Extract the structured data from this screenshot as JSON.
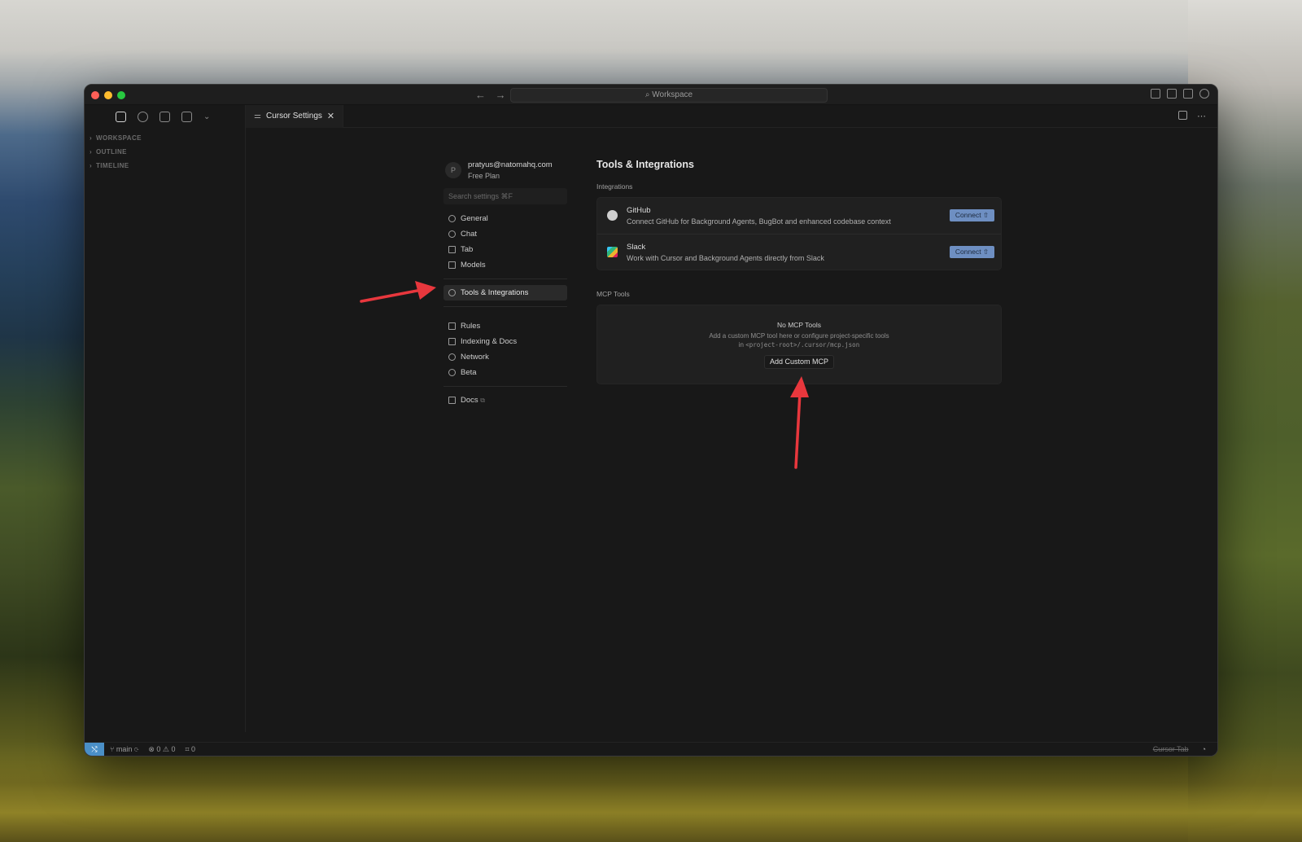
{
  "window": {
    "search_label": "Workspace",
    "nav_back": "←",
    "nav_forward": "→"
  },
  "sidebar": {
    "sections": [
      "WORKSPACE",
      "OUTLINE",
      "TIMELINE"
    ]
  },
  "tab": {
    "label": "Cursor Settings",
    "close": "✕"
  },
  "account": {
    "avatar_letter": "P",
    "email": "pratyus@natomahq.com",
    "plan": "Free Plan"
  },
  "settings_search": {
    "placeholder": "Search settings ⌘F"
  },
  "nav": {
    "general": "General",
    "chat": "Chat",
    "tab": "Tab",
    "models": "Models",
    "tools": "Tools & Integrations",
    "rules": "Rules",
    "indexing": "Indexing & Docs",
    "network": "Network",
    "beta": "Beta",
    "docs": "Docs"
  },
  "main": {
    "title": "Tools & Integrations",
    "integrations_heading": "Integrations",
    "integrations": [
      {
        "name": "GitHub",
        "desc": "Connect GitHub for Background Agents, BugBot and enhanced codebase context",
        "button": "Connect ⇧"
      },
      {
        "name": "Slack",
        "desc": "Work with Cursor and Background Agents directly from Slack",
        "button": "Connect ⇧"
      }
    ],
    "mcp_heading": "MCP Tools",
    "mcp_empty_title": "No MCP Tools",
    "mcp_help_line1": "Add a custom MCP tool here or configure project-specific tools",
    "mcp_help_line2_prefix": "in",
    "mcp_help_line2_code": "<project-root>/.cursor/mcp.json",
    "add_button": "Add Custom MCP"
  },
  "status": {
    "remote": "⤭",
    "branch": "main",
    "problems": "⊗ 0 ⚠ 0",
    "ports": "⌗ 0",
    "cursor_tab": "Cursor Tab",
    "bell": "🔔"
  },
  "colors": {
    "accent": "#6e8fc2",
    "annotation_arrow": "#e8373d",
    "remote_badge": "#4a8fc7"
  }
}
